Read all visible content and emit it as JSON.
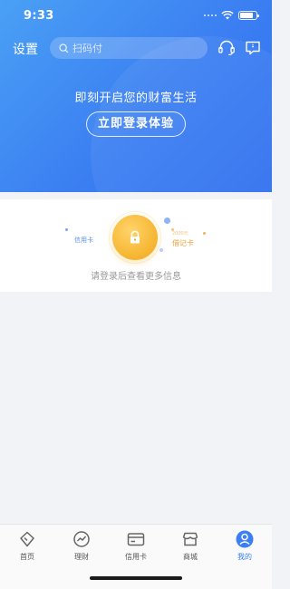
{
  "status_bar": {
    "time": "9:33",
    "battery_level": 0.85
  },
  "topbar": {
    "settings_label": "设置",
    "search_placeholder": "扫码付"
  },
  "hero": {
    "tagline": "即刻开启您的财富生活",
    "login_button": "立即登录体验"
  },
  "card": {
    "credit_label": "信用卡",
    "debit_label": "借记卡",
    "debit_small_label": "2000元",
    "hint": "请登录后查看更多信息"
  },
  "tabs": [
    {
      "label": "首页",
      "icon": "home-icon",
      "active": false
    },
    {
      "label": "理财",
      "icon": "wealth-icon",
      "active": false
    },
    {
      "label": "信用卡",
      "icon": "credit-card-icon",
      "active": false
    },
    {
      "label": "商城",
      "icon": "store-icon",
      "active": false
    },
    {
      "label": "我的",
      "icon": "profile-icon",
      "active": true
    }
  ],
  "colors": {
    "accent": "#3b7ff2",
    "lock": "#f7b936",
    "background": "#f2f3f7"
  }
}
